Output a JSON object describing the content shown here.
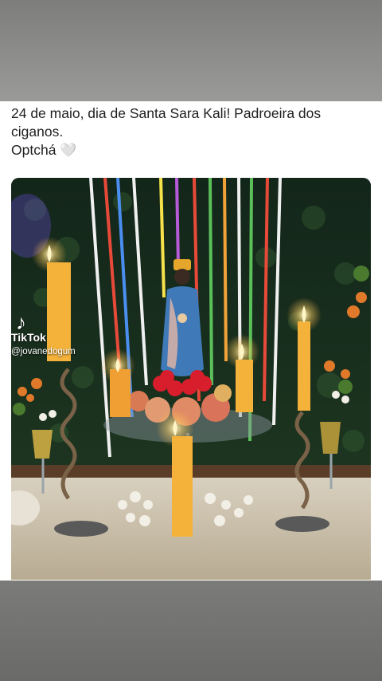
{
  "post": {
    "caption_line1": "24 de maio, dia de Santa Sara Kali! Padroeira dos",
    "caption_line2": "ciganos.",
    "caption_line3": "Optchá",
    "heart_emoji": "🤍"
  },
  "overlay": {
    "logo_glyph": "♪",
    "brand": "TikTok",
    "handle": "@jovanedogum"
  },
  "colors": {
    "flame": "#ffd36b",
    "candle": "#f4b23a",
    "ribbons": [
      "#e84a3a",
      "#f1a33a",
      "#f5e24a",
      "#5bc05a",
      "#4a8ef0",
      "#b65ad8",
      "#f0f0f0"
    ]
  }
}
